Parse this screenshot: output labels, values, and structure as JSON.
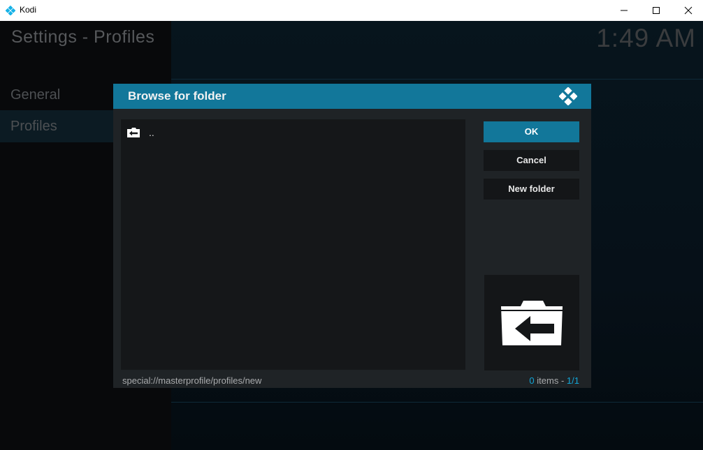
{
  "window": {
    "title": "Kodi",
    "min_symbol": "—",
    "max_symbol": "☐",
    "close_symbol": "✕"
  },
  "page": {
    "title": "Settings - Profiles",
    "clock": "1:49 AM"
  },
  "sidebar": {
    "items": [
      {
        "label": "General",
        "selected": false
      },
      {
        "label": "Profiles",
        "selected": true
      }
    ]
  },
  "dialog": {
    "title": "Browse for folder",
    "logo_icon": "kodi-logo-icon",
    "list": {
      "items": [
        {
          "label": "..",
          "icon": "folder-back-icon"
        }
      ]
    },
    "buttons": {
      "ok": "OK",
      "cancel": "Cancel",
      "new_folder": "New folder"
    },
    "thumbnail_icon": "folder-back-icon",
    "path": "special://masterprofile/profiles/new",
    "count": {
      "items": "0",
      "items_label": "items",
      "separator": "-",
      "page": "1/1"
    }
  },
  "colors": {
    "accent": "#12779a",
    "accent_text": "#12a6d8",
    "dialog_bg": "#1f2326",
    "list_bg": "#151719"
  }
}
